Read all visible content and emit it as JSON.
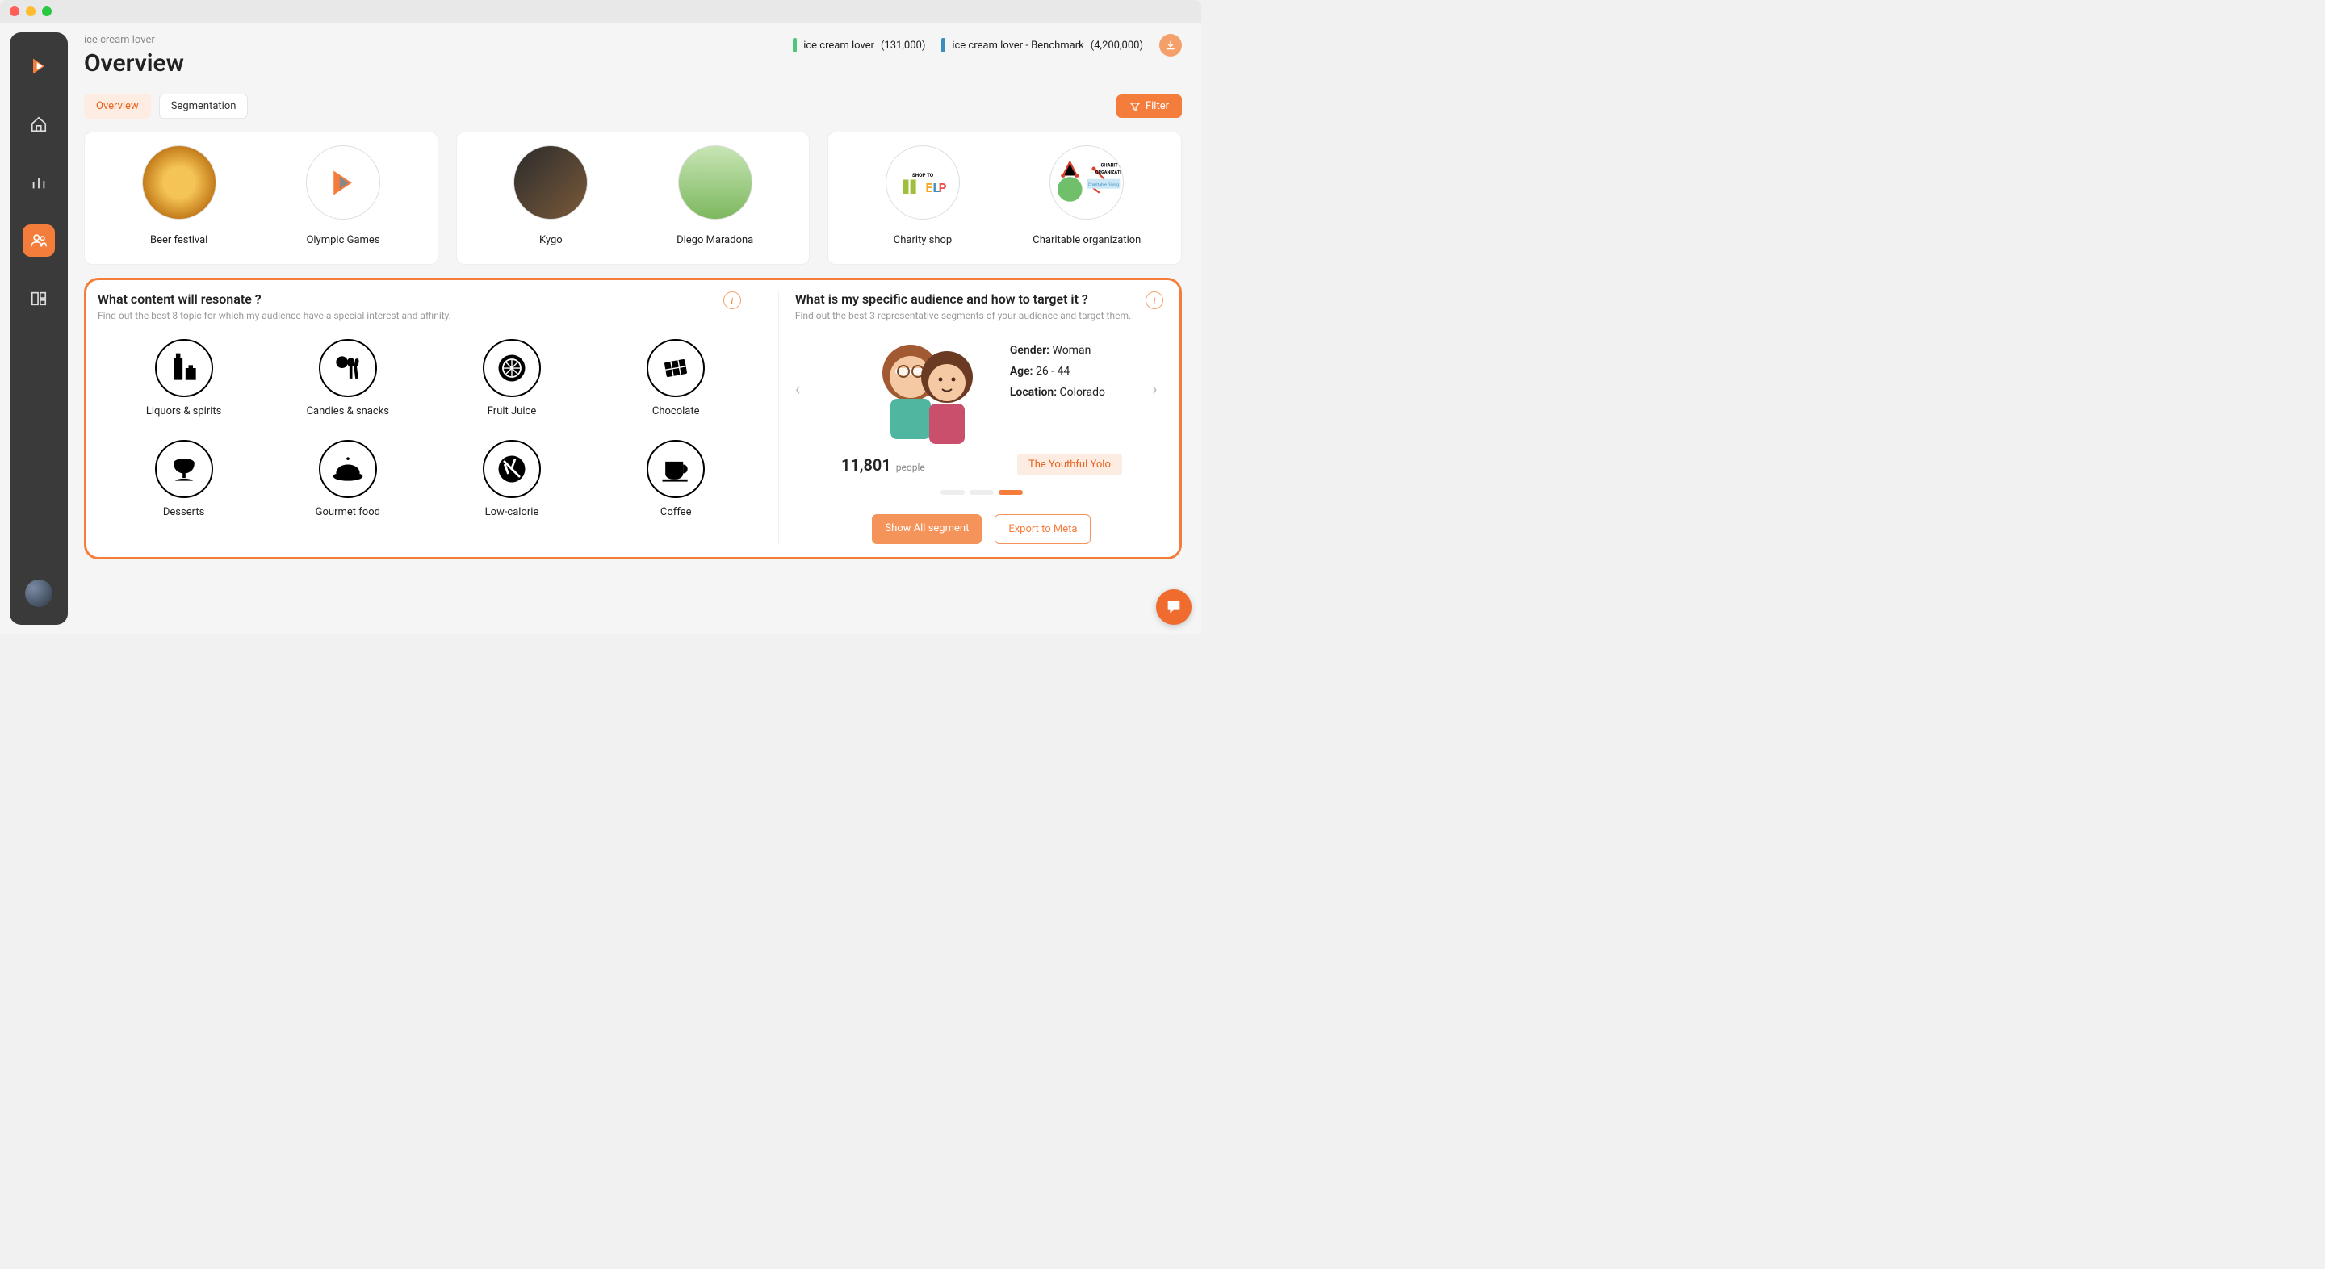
{
  "breadcrumb": "ice cream lover",
  "page_title": "Overview",
  "legend": {
    "item1_color": "#4fc67a",
    "item1_label": "ice cream lover",
    "item1_value": "(131,000)",
    "item2_color": "#3b8dbd",
    "item2_label": "ice cream lover - Benchmark",
    "item2_value": "(4,200,000)"
  },
  "tabs": {
    "overview": "Overview",
    "segmentation": "Segmentation"
  },
  "filter_label": "Filter",
  "top_cards": [
    {
      "left": "Beer festival",
      "right": "Olympic Games"
    },
    {
      "left": "Kygo",
      "right": "Diego Maradona"
    },
    {
      "left": "Charity shop",
      "right": "Charitable organization"
    }
  ],
  "content_panel": {
    "title": "What content will resonate ?",
    "subtitle": "Find out the best 8 topic for which my audience have a special interest and affinity.",
    "topics": [
      "Liquors & spirits",
      "Candies & snacks",
      "Fruit Juice",
      "Chocolate",
      "Desserts",
      "Gourmet food",
      "Low-calorie",
      "Coffee"
    ]
  },
  "audience_panel": {
    "title": "What is my specific audience and how to target it ?",
    "subtitle": "Find out the best 3 representative segments of your audience and target them.",
    "gender_label": "Gender:",
    "gender_value": "Woman",
    "age_label": "Age:",
    "age_value": "26 - 44",
    "location_label": "Location:",
    "location_value": "Colorado",
    "count": "11,801",
    "count_unit": "people",
    "persona": "The Youthful Yolo",
    "actions": {
      "show_all": "Show All segment",
      "export_meta": "Export to Meta"
    }
  }
}
